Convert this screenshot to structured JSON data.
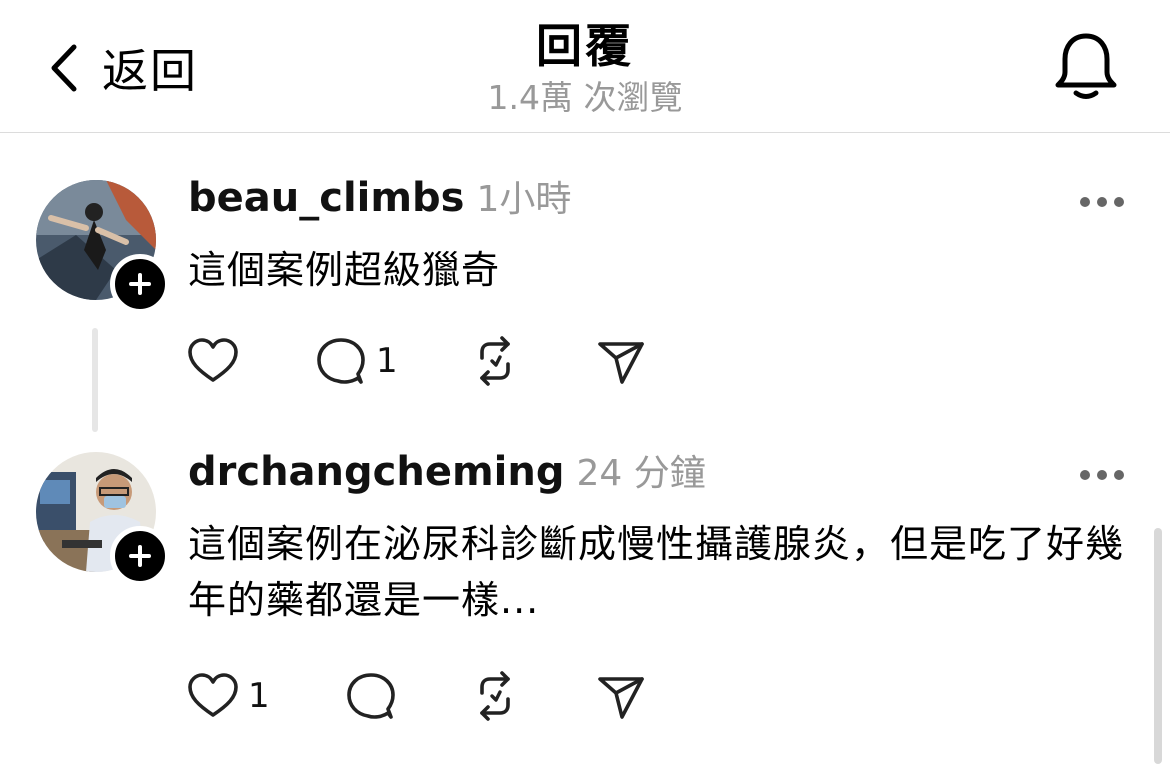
{
  "header": {
    "back_label": "返回",
    "title": "回覆",
    "views": "1.4萬 次瀏覽"
  },
  "posts": [
    {
      "username": "beau_climbs",
      "time": "1小時",
      "text": "這個案例超級獵奇",
      "likes": "",
      "replies": "1"
    },
    {
      "username": "drchangcheming",
      "time": "24 分鐘",
      "text": "這個案例在泌尿科診斷成慢性攝護腺炎，但是吃了好幾年的藥都還是一樣...",
      "likes": "1",
      "replies": ""
    }
  ],
  "icons": {
    "back": "chevron-left-icon",
    "notifications": "bell-icon",
    "more": "more-horizontal-icon",
    "like": "heart-icon",
    "reply": "comment-bubble-icon",
    "repost": "repost-icon",
    "share": "send-icon",
    "follow": "plus-icon"
  }
}
